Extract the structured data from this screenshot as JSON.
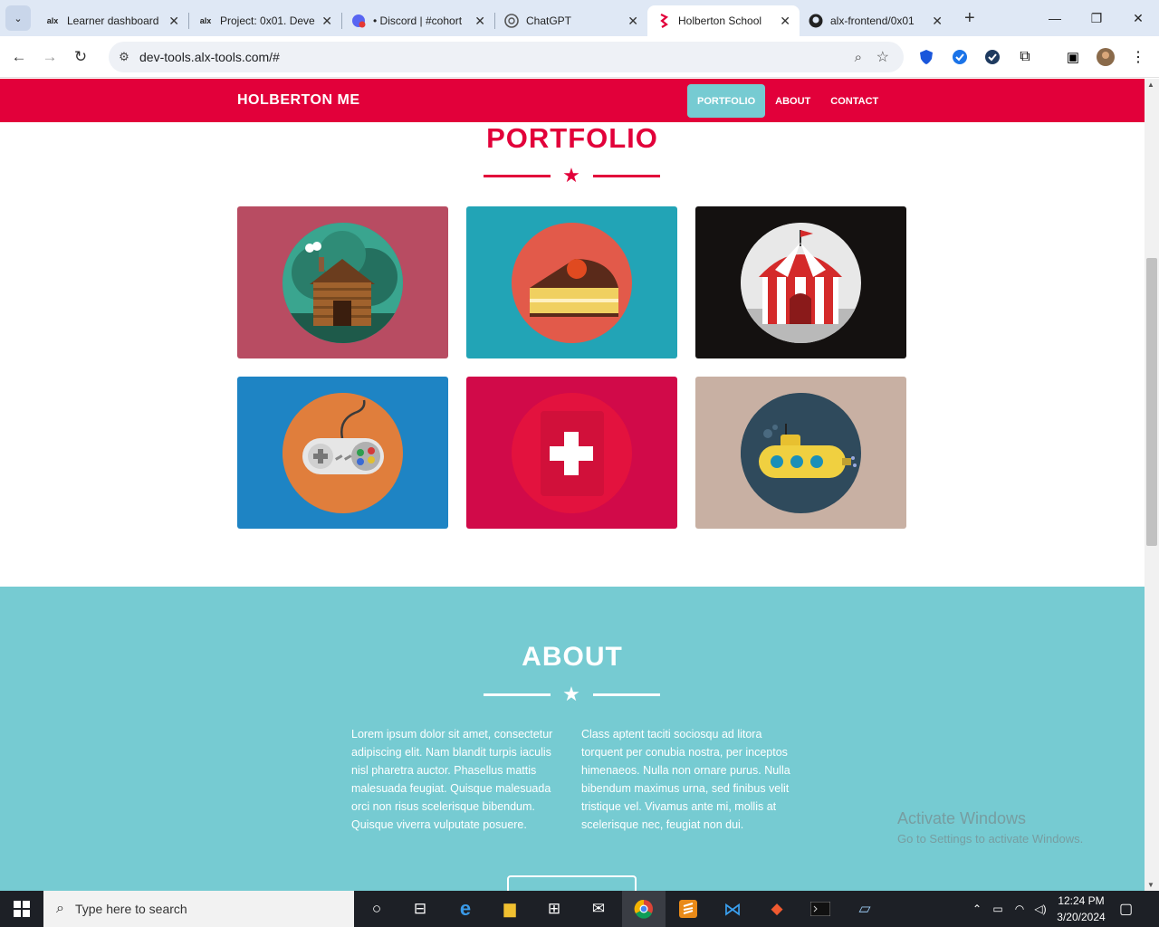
{
  "browser": {
    "tabs": [
      {
        "title": "Learner dashboard",
        "favicon": "alx"
      },
      {
        "title": "Project: 0x01. Deve",
        "favicon": "alx"
      },
      {
        "title": "• Discord | #cohort",
        "favicon": "discord"
      },
      {
        "title": "ChatGPT",
        "favicon": "chatgpt"
      },
      {
        "title": "Holberton School",
        "favicon": "holberton"
      },
      {
        "title": "alx-frontend/0x01",
        "favicon": "github"
      }
    ],
    "active_tab": 4,
    "url": "dev-tools.alx-tools.com/#",
    "tab_close_glyph": "✕",
    "new_tab_glyph": "+"
  },
  "site": {
    "brand": "HOLBERTON ME",
    "nav": [
      {
        "label": "PORTFOLIO",
        "active": true
      },
      {
        "label": "ABOUT",
        "active": false
      },
      {
        "label": "CONTACT",
        "active": false
      }
    ],
    "accent_color": "#e2003a",
    "teal_color": "#76cbd2",
    "portfolio": {
      "title": "PORTFOLIO",
      "items": [
        {
          "icon": "log-cabin-icon",
          "bg": "#b84c62",
          "circle": "#2c8a7a"
        },
        {
          "icon": "cake-slice-icon",
          "bg": "#22a4b6",
          "circle": "#e25a4a"
        },
        {
          "icon": "circus-tent-icon",
          "bg": "#141110",
          "circle": "#e6e6e6"
        },
        {
          "icon": "game-controller-icon",
          "bg": "#1e84c4",
          "circle": "#e07e3c"
        },
        {
          "icon": "safe-plus-icon",
          "bg": "#d10a49",
          "circle": "#e3123e"
        },
        {
          "icon": "submarine-icon",
          "bg": "#c8b0a3",
          "circle": "#2f4a5c"
        }
      ]
    },
    "about": {
      "title": "ABOUT",
      "col1": "Lorem ipsum dolor sit amet, consectetur adipiscing elit. Nam blandit turpis iaculis nisl pharetra auctor. Phasellus mattis malesuada feugiat. Quisque malesuada orci non risus scelerisque bibendum. Quisque viverra vulputate posuere.",
      "col2": "Class aptent taciti sociosqu ad litora torquent per conubia nostra, per inceptos himenaeos. Nulla non ornare purus. Nulla bibendum maximus urna, sed finibus velit tristique vel. Vivamus ante mi, mollis at scelerisque nec, feugiat non dui."
    }
  },
  "windows": {
    "activate_title": "Activate Windows",
    "activate_sub": "Go to Settings to activate Windows.",
    "search_placeholder": "Type here to search",
    "time": "12:24 PM",
    "date": "3/20/2024"
  }
}
